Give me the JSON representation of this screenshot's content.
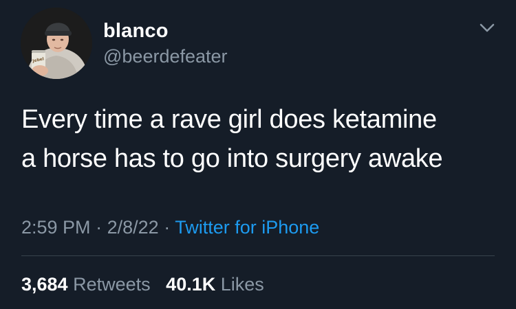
{
  "tweet": {
    "author": {
      "display_name": "blanco",
      "handle": "@beerdefeater",
      "avatar_can_text": "Jebel"
    },
    "text_lines": [
      "Every time a rave girl does ketamine",
      "a horse has to go into surgery awake"
    ],
    "time": "2:59 PM",
    "separator": "·",
    "date": "2/8/22",
    "source": "Twitter for iPhone",
    "retweets": {
      "count": "3,684",
      "label": "Retweets"
    },
    "likes": {
      "count": "40.1K",
      "label": "Likes"
    },
    "menu_icon": "chevron-down-icon"
  },
  "colors": {
    "background": "#151d28",
    "primary_text": "#ffffff",
    "secondary_text": "#8b98a5",
    "link": "#1d9bf0",
    "divider": "#38444d"
  }
}
